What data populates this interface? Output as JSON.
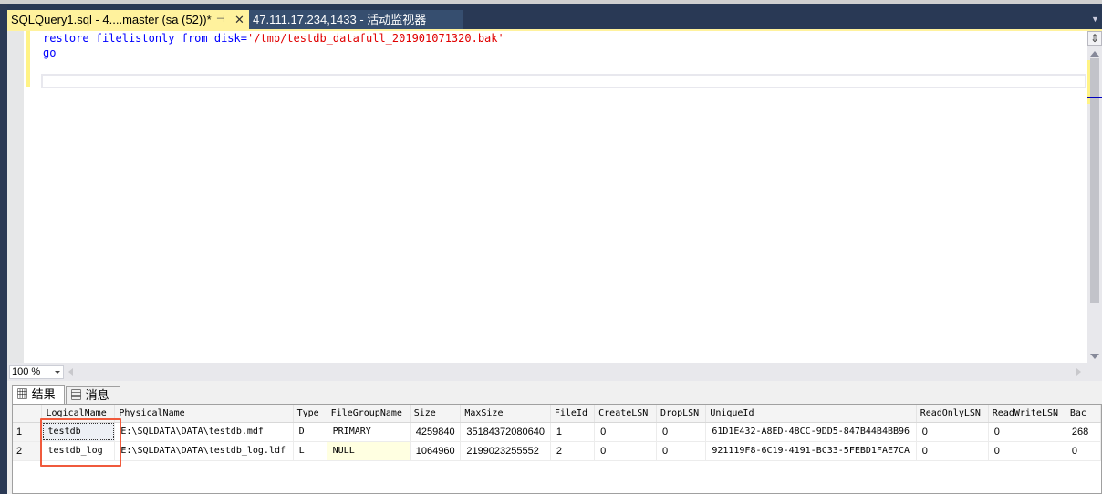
{
  "tabs": [
    {
      "label": "SQLQuery1.sql - 4....master (sa (52))*",
      "active": true,
      "pin_icon": "⊣",
      "close_icon": "✕"
    },
    {
      "label": "47.111.17.234,1433 - 活动监视器",
      "active": false
    }
  ],
  "editor": {
    "lines": [
      {
        "keyword": "restore filelistonly from disk=",
        "string": "'/tmp/testdb_datafull_201901071320.bak'"
      },
      {
        "keyword": "go",
        "string": ""
      }
    ]
  },
  "zoom": {
    "value": "100 %"
  },
  "results": {
    "tabs": [
      {
        "label": "结果",
        "icon": "grid-icon"
      },
      {
        "label": "消息",
        "icon": "messages-icon"
      }
    ],
    "columns": [
      "",
      "LogicalName",
      "PhysicalName",
      "Type",
      "FileGroupName",
      "Size",
      "MaxSize",
      "FileId",
      "CreateLSN",
      "DropLSN",
      "UniqueId",
      "ReadOnlyLSN",
      "ReadWriteLSN",
      "Bac"
    ],
    "rows": [
      [
        "1",
        "testdb",
        "E:\\SQLDATA\\DATA\\testdb.mdf",
        "D",
        "PRIMARY",
        "4259840",
        "35184372080640",
        "1",
        "0",
        "0",
        "61D1E432-A8ED-48CC-9DD5-847B44B4BB96",
        "0",
        "0",
        "268"
      ],
      [
        "2",
        "testdb_log",
        "E:\\SQLDATA\\DATA\\testdb_log.ldf",
        "L",
        "NULL",
        "1064960",
        "2199023255552",
        "2",
        "0",
        "0",
        "921119F8-6C19-4191-BC33-5FEBD1FAE7CA",
        "0",
        "0",
        "0"
      ]
    ]
  },
  "highlight_color": "#f05a3c"
}
